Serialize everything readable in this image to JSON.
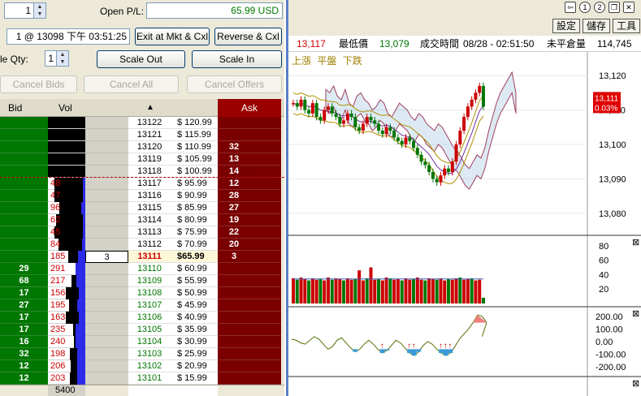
{
  "controls": {
    "qty_top": "1",
    "open_pl_label": "Open P/L:",
    "open_pl_value": "65.99 USD",
    "position_text": "1 @ 13098 下午 03:51:25",
    "exit_button": "Exit at Mkt & Cxl",
    "reverse_button": "Reverse & Cxl",
    "scale_qty_label": "le Qty:",
    "scale_qty_value": "1",
    "scale_out_button": "Scale Out",
    "scale_in_button": "Scale In",
    "cancel_bids_button": "Cancel Bids",
    "cancel_all_button": "Cancel All",
    "cancel_offers_button": "Cancel Offers"
  },
  "ladder": {
    "headers": {
      "bid": "Bid",
      "vol": "Vol",
      "ask": "Ask",
      "sort_icon": "up-triangle"
    },
    "current_price": "13111",
    "my_order_qty": "3",
    "footer_volume": "5400",
    "rows": [
      {
        "bid": "",
        "vol": "",
        "price": "13122",
        "usd": "$ 120.99",
        "ask": ""
      },
      {
        "bid": "",
        "vol": "",
        "price": "13121",
        "usd": "$ 115.99",
        "ask": ""
      },
      {
        "bid": "",
        "vol": "",
        "price": "13120",
        "usd": "$ 110.99",
        "ask": "32"
      },
      {
        "bid": "",
        "vol": "",
        "price": "13119",
        "usd": "$ 105.99",
        "ask": "13"
      },
      {
        "bid": "",
        "vol": "",
        "price": "13118",
        "usd": "$ 100.99",
        "ask": "14"
      },
      {
        "bid": "",
        "vol": "48",
        "price": "13117",
        "usd": "$ 95.99",
        "ask": "12"
      },
      {
        "bid": "",
        "vol": "47",
        "price": "13116",
        "usd": "$ 90.99",
        "ask": "28"
      },
      {
        "bid": "",
        "vol": "96",
        "price": "13115",
        "usd": "$ 85.99",
        "ask": "27"
      },
      {
        "bid": "",
        "vol": "62",
        "price": "13114",
        "usd": "$ 80.99",
        "ask": "19"
      },
      {
        "bid": "",
        "vol": "45",
        "price": "13113",
        "usd": "$ 75.99",
        "ask": "22"
      },
      {
        "bid": "",
        "vol": "84",
        "price": "13112",
        "usd": "$ 70.99",
        "ask": "20"
      },
      {
        "bid": "",
        "vol": "185",
        "price": "13111",
        "usd": "$65.99",
        "ask": "3"
      },
      {
        "bid": "29",
        "vol": "291",
        "price": "13110",
        "usd": "$ 60.99",
        "ask": ""
      },
      {
        "bid": "68",
        "vol": "217",
        "price": "13109",
        "usd": "$ 55.99",
        "ask": ""
      },
      {
        "bid": "17",
        "vol": "156",
        "price": "13108",
        "usd": "$ 50.99",
        "ask": ""
      },
      {
        "bid": "27",
        "vol": "195",
        "price": "13107",
        "usd": "$ 45.99",
        "ask": ""
      },
      {
        "bid": "17",
        "vol": "163",
        "price": "13106",
        "usd": "$ 40.99",
        "ask": ""
      },
      {
        "bid": "17",
        "vol": "235",
        "price": "13105",
        "usd": "$ 35.99",
        "ask": ""
      },
      {
        "bid": "16",
        "vol": "240",
        "price": "13104",
        "usd": "$ 30.99",
        "ask": ""
      },
      {
        "bid": "32",
        "vol": "198",
        "price": "13103",
        "usd": "$ 25.99",
        "ask": ""
      },
      {
        "bid": "12",
        "vol": "206",
        "price": "13102",
        "usd": "$ 20.99",
        "ask": ""
      },
      {
        "bid": "12",
        "vol": "203",
        "price": "13101",
        "usd": "$ 15.99",
        "ask": ""
      }
    ]
  },
  "chart_panel": {
    "toolbar_icons": [
      "pin-icon",
      "circle-1-icon",
      "circle-2-icon",
      "restore-icon",
      "close-icon"
    ],
    "buttons": [
      "設定",
      "儲存",
      "工具"
    ],
    "info": {
      "last": "13,117",
      "low_label": "最低價",
      "low_value": "13,079",
      "time_label": "成交時間",
      "time_value": "08/28 - 02:51:50",
      "oi_label": "未平倉量",
      "oi_value": "114,745"
    },
    "legend": [
      "上漲",
      "平盤",
      "下跌"
    ],
    "price_ticks": [
      "13,120",
      "13,110",
      "13,100",
      "13,090",
      "13,080"
    ],
    "price_tag": "13,111",
    "price_tag_pct": "0.03%",
    "volume_ticks": [
      "80",
      "60",
      "40",
      "20"
    ],
    "osc_ticks": [
      "200.00",
      "100.00",
      "0.00",
      "-100.00",
      "-200.00"
    ],
    "colors": {
      "up": "#cc0000",
      "down": "#007700",
      "frame": "#5b7ec9"
    }
  },
  "chart_data": [
    {
      "type": "line",
      "title": "",
      "ylim": [
        13075,
        13125
      ],
      "x": [
        1,
        2,
        3,
        4,
        5,
        6,
        7,
        8,
        9,
        10,
        11,
        12,
        13,
        14,
        15,
        16,
        17,
        18,
        19,
        20,
        21,
        22,
        23,
        24,
        25,
        26,
        27,
        28,
        29,
        30,
        31,
        32,
        33,
        34,
        35,
        36,
        37,
        38,
        39,
        40,
        41,
        42,
        43,
        44,
        45,
        46,
        47,
        48,
        49,
        50
      ],
      "series": [
        {
          "values": [
            13112,
            13111,
            13113,
            13110,
            13109,
            13112,
            13108,
            13107,
            13110,
            13111,
            13109,
            13108,
            13106,
            13107,
            13109,
            13108,
            13105,
            13104,
            13106,
            13108,
            13107,
            13106,
            13104,
            13103,
            13105,
            13104,
            13102,
            13101,
            13100,
            13102,
            13101,
            13099,
            13097,
            13095,
            13094,
            13092,
            13090,
            13089,
            13091,
            13093,
            13092,
            13095,
            13100,
            13104,
            13108,
            13111,
            13113,
            13115,
            13117,
            13111
          ]
        }
      ]
    },
    {
      "type": "bar",
      "ylim": [
        0,
        90
      ],
      "series": [
        {
          "values": [
            35,
            33,
            36,
            34,
            32,
            35,
            33,
            34,
            32,
            36,
            33,
            35,
            34,
            32,
            35,
            33,
            34,
            46,
            32,
            35,
            50,
            33,
            34,
            32,
            36,
            35,
            33,
            34,
            32,
            35,
            33,
            34,
            36,
            33,
            32,
            35,
            34,
            33,
            35,
            32,
            34,
            33,
            35,
            36,
            33,
            34,
            35,
            32,
            33,
            8
          ]
        }
      ]
    },
    {
      "type": "line",
      "ylim": [
        -250,
        250
      ],
      "series": [
        {
          "values": [
            20,
            10,
            -10,
            -20,
            10,
            40,
            20,
            -20,
            -60,
            -40,
            10,
            30,
            -10,
            -50,
            -80,
            -60,
            -20,
            10,
            -20,
            -60,
            -90,
            -70,
            -30,
            10,
            -10,
            -50,
            -90,
            -110,
            -80,
            -30,
            0,
            -20,
            -60,
            -90,
            -110,
            -90,
            -40,
            20,
            60,
            100,
            150,
            210,
            200,
            150
          ]
        }
      ]
    }
  ]
}
